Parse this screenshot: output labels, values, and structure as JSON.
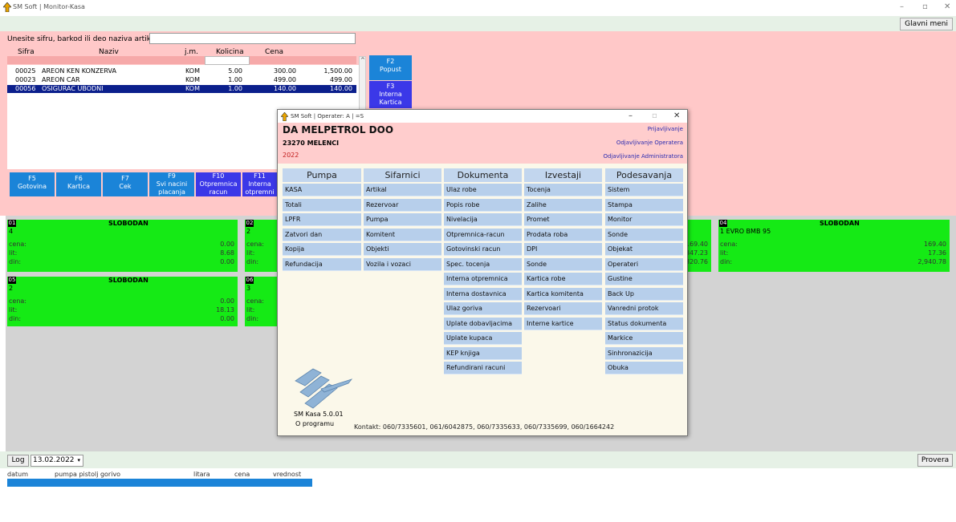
{
  "window": {
    "title": "SM Soft | Monitor-Kasa",
    "glavni_meni": "Glavni meni"
  },
  "search": {
    "label": "Unesite sifru, barkod ili deo naziva artikla",
    "value": ""
  },
  "table": {
    "headers": [
      "Sifra",
      "Naziv",
      "j.m.",
      "Kolicina",
      "Cena"
    ],
    "rows": [
      {
        "sifra": "00025",
        "naziv": "AREON KEN KONZERVA",
        "jm": "KOM",
        "kolicina": "5.00",
        "cena": "300.00",
        "iznos": "1,500.00"
      },
      {
        "sifra": "00023",
        "naziv": "AREON CAR",
        "jm": "KOM",
        "kolicina": "1.00",
        "cena": "499.00",
        "iznos": "499.00"
      },
      {
        "sifra": "00056",
        "naziv": "OSIGURAC UBODNI",
        "jm": "KOM",
        "kolicina": "1.00",
        "cena": "140.00",
        "iznos": "140.00"
      }
    ]
  },
  "side_keys": {
    "f2_key": "F2",
    "f2_label": "Popust",
    "f3_key": "F3",
    "f3_label1": "Interna",
    "f3_label2": "Kartica"
  },
  "fkeys": {
    "f5_key": "F5",
    "f5_label": "Gotovina",
    "f6_key": "F6",
    "f6_label": "Kartica",
    "f7_key": "F7",
    "f7_label": "Cek",
    "f9_key": "F9",
    "f9_label1": "Svi nacini",
    "f9_label2": "placanja",
    "f10_key": "F10",
    "f10_label1": "Otpremnica",
    "f10_label2": "racun",
    "f11_key": "F11",
    "f11_label1": "Interna",
    "f11_label2": "otpremni"
  },
  "pumps": {
    "p1": {
      "num": "01",
      "status": "SLOBODAN",
      "fuel": "4",
      "cena_label": "cena:",
      "cena": "0.00",
      "lit_label": "lit:",
      "lit": "8.68",
      "din_label": "din:",
      "din": "0.00"
    },
    "p2": {
      "num": "02",
      "fuel": "2",
      "cena_label": "cena:",
      "lit_label": "lit:",
      "din_label": "din:"
    },
    "p3_partial": {
      "cena": "169.40",
      "lit": "347.23",
      "din": "320.76"
    },
    "p4": {
      "num": "04",
      "status": "SLOBODAN",
      "fuel": "1 EVRO BMB 95",
      "cena_label": "cena:",
      "cena": "169.40",
      "lit_label": "lit:",
      "lit": "17.36",
      "din_label": "din:",
      "din": "2,940.78"
    },
    "p5": {
      "num": "05",
      "status": "SLOBODAN",
      "fuel": "2",
      "cena_label": "cena:",
      "cena": "0.00",
      "lit_label": "lit:",
      "lit": "18.13",
      "din_label": "din:",
      "din": "0.00"
    },
    "p6": {
      "num": "06",
      "fuel": "3",
      "cena_label": "cena:",
      "lit_label": "lit:",
      "din_label": "din:"
    }
  },
  "log": {
    "button": "Log",
    "date": "13.02.2022",
    "provera": "Provera",
    "headers": {
      "datum": "datum",
      "pumpa": "pumpa pistolj gorivo",
      "litara": "litara",
      "cena": "cena",
      "vrednost": "vrednost"
    }
  },
  "dialog": {
    "title": "SM Soft | Operater: A | =S",
    "company": "DA MELPETROL DOO",
    "city": "23270 MELENCI",
    "year": "2022",
    "links": {
      "prijavljivanje": "Prijavljivanje",
      "odjava_operatera": "Odjavljivanje Operatera",
      "odjava_admin": "Odjavljivanje Administratora"
    },
    "columns": {
      "pumpa": {
        "title": "Pumpa",
        "items": [
          "KASA",
          "Totali",
          "LPFR",
          "Zatvori dan",
          "Kopija",
          "Refundacija"
        ]
      },
      "sifarnici": {
        "title": "Sifarnici",
        "items": [
          "Artikal",
          "Rezervoar",
          "Pumpa",
          "Komitent",
          "Objekti",
          "Vozila i vozaci"
        ]
      },
      "dokumenta": {
        "title": "Dokumenta",
        "items": [
          "Ulaz robe",
          "Popis robe",
          "Nivelacija",
          "Otpremnica-racun",
          "Gotovinski racun",
          "Spec. tocenja",
          "Interna otpremnica",
          "Interna dostavnica",
          "Ulaz goriva",
          "Uplate dobavljacima",
          "Uplate kupaca",
          "KEP knjiga",
          "Refundirani racuni"
        ]
      },
      "izvestaji": {
        "title": "Izvestaji",
        "items": [
          "Tocenja",
          "Zalihe",
          "Promet",
          "Prodata roba",
          "DPI",
          "Sonde",
          "Kartica robe",
          "Kartica komitenta",
          "Rezervoari",
          "Interne kartice"
        ]
      },
      "podesavanja": {
        "title": "Podesavanja",
        "items": [
          "Sistem",
          "Stampa",
          "Monitor",
          "Sonde",
          "Objekat",
          "Operateri",
          "Gustine",
          "Back Up",
          "Vanredni protok",
          "Status dokumenta",
          "Markice",
          "Sinhronazicija",
          "Obuka"
        ]
      }
    },
    "version": "SM Kasa 5.0.01",
    "about": "O programu",
    "contact": "Kontakt: 060/7335601, 061/6042875, 060/7335633, 060/7335699, 060/1664242"
  }
}
